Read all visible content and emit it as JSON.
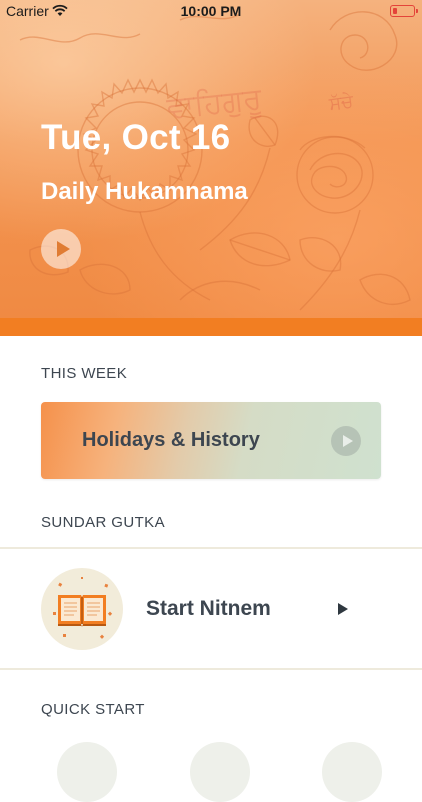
{
  "status_bar": {
    "carrier": "Carrier",
    "time": "10:00 PM"
  },
  "hero": {
    "date": "Tue, Oct 16",
    "subtitle": "Daily Hukamnama",
    "gurmukhi_text_1": "ਵਾਹਿਗੁਰੂ",
    "gurmukhi_text_2": "ਸੱਚੇ"
  },
  "this_week": {
    "heading": "THIS WEEK",
    "card_label": "Holidays & History"
  },
  "sundar_gutka": {
    "heading": "SUNDAR GUTKA",
    "item_label": "Start Nitnem"
  },
  "quick_start": {
    "heading": "QUICK START"
  },
  "colors": {
    "accent_orange": "#f27e22",
    "text_dark": "#3d4650"
  },
  "icons": {
    "wifi": "wifi-icon",
    "battery": "battery-icon",
    "play": "play-icon",
    "book": "book-icon",
    "arrow": "play-arrow-icon"
  }
}
